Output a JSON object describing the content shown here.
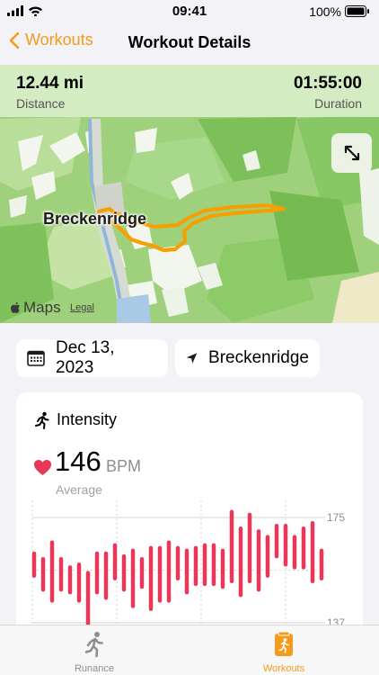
{
  "status_bar": {
    "time": "09:41",
    "battery": "100%"
  },
  "nav": {
    "back_label": "Workouts",
    "title": "Workout Details"
  },
  "map": {
    "distance_value": "12.44 mi",
    "distance_label": "Distance",
    "duration_value": "01:55:00",
    "duration_label": "Duration",
    "town_label": "Breckenridge",
    "attribution": "Maps",
    "legal_label": "Legal"
  },
  "info": {
    "date": "Dec 13, 2023",
    "location": "Breckenridge"
  },
  "intensity": {
    "title": "Intensity",
    "hr_value": "146",
    "hr_unit": "BPM",
    "hr_sub": "Average"
  },
  "chart_data": {
    "type": "bar",
    "subtype": "range",
    "bar_color": "#e8385a",
    "y_ticks": [
      "175",
      "137"
    ],
    "ylim": [
      137,
      175
    ],
    "ranges": [
      [
        154,
        162
      ],
      [
        149,
        160
      ],
      [
        145,
        166
      ],
      [
        149,
        160
      ],
      [
        148,
        157
      ],
      [
        145,
        158
      ],
      [
        135,
        155
      ],
      [
        148,
        162
      ],
      [
        146,
        162
      ],
      [
        153,
        165
      ],
      [
        149,
        161
      ],
      [
        143,
        163
      ],
      [
        150,
        160
      ],
      [
        142,
        164
      ],
      [
        145,
        164
      ],
      [
        145,
        166
      ],
      [
        153,
        164
      ],
      [
        148,
        163
      ],
      [
        151,
        164
      ],
      [
        151,
        165
      ],
      [
        151,
        165
      ],
      [
        150,
        163
      ],
      [
        152,
        177
      ],
      [
        147,
        171
      ],
      [
        152,
        176
      ],
      [
        149,
        170
      ],
      [
        154,
        168
      ],
      [
        161,
        172
      ],
      [
        158,
        172
      ],
      [
        157,
        168
      ],
      [
        157,
        171
      ],
      [
        152,
        173
      ],
      [
        153,
        163
      ]
    ]
  },
  "tabs": [
    {
      "label": "Runance"
    },
    {
      "label": "Workouts"
    }
  ],
  "colors": {
    "accent": "#f49b1b",
    "heart": "#e8385a",
    "route": "#f5a000"
  }
}
